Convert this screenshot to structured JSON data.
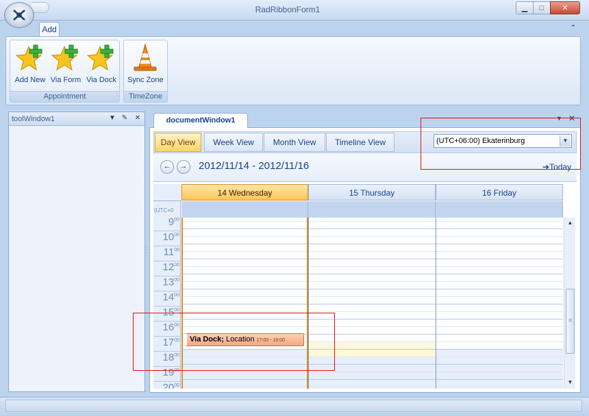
{
  "window": {
    "title": "RadRibbonForm1",
    "minimize": "▁",
    "maximize": "□",
    "close": "✕"
  },
  "ribbon": {
    "tabs": [
      {
        "label": "Add"
      }
    ],
    "collapse_icon": "chevron-up-icon",
    "groups": [
      {
        "label": "Appointment",
        "buttons": [
          {
            "label": "Add New",
            "icon": "star-add-icon"
          },
          {
            "label": "Via Form",
            "icon": "star-add-icon"
          },
          {
            "label": "Via Dock",
            "icon": "star-add-icon"
          }
        ]
      },
      {
        "label": "TimeZone",
        "buttons": [
          {
            "label": "Sync Zone",
            "icon": "traffic-cone-icon"
          }
        ]
      }
    ]
  },
  "tool_window": {
    "title": "toolWindow1"
  },
  "document_window": {
    "title": "documentWindow1"
  },
  "scheduler": {
    "views": [
      {
        "label": "Day View",
        "active": true
      },
      {
        "label": "Week View",
        "active": false
      },
      {
        "label": "Month View",
        "active": false
      },
      {
        "label": "Timeline View",
        "active": false
      }
    ],
    "timezone": "(UTC+06:00) Ekaterinburg",
    "date_range": "2012/11/14 - 2012/11/16",
    "today_label": "Today",
    "timezone_short": "(UTC+0",
    "days": [
      {
        "label": "14 Wednesday",
        "today": true
      },
      {
        "label": "15 Thursday",
        "today": false
      },
      {
        "label": "16 Friday",
        "today": false
      }
    ],
    "hours": [
      "9",
      "10",
      "11",
      "12",
      "13",
      "14",
      "15",
      "16",
      "17",
      "18",
      "19",
      "20"
    ],
    "minutes_suffix": "00",
    "appointment": {
      "subject": "Via Dock;",
      "location": "Location",
      "time": "17:00 - 18:00"
    }
  },
  "colors": {
    "accent_today": "#fbc55a",
    "appointment": "#f5a77f",
    "highlight": "#e01010"
  }
}
